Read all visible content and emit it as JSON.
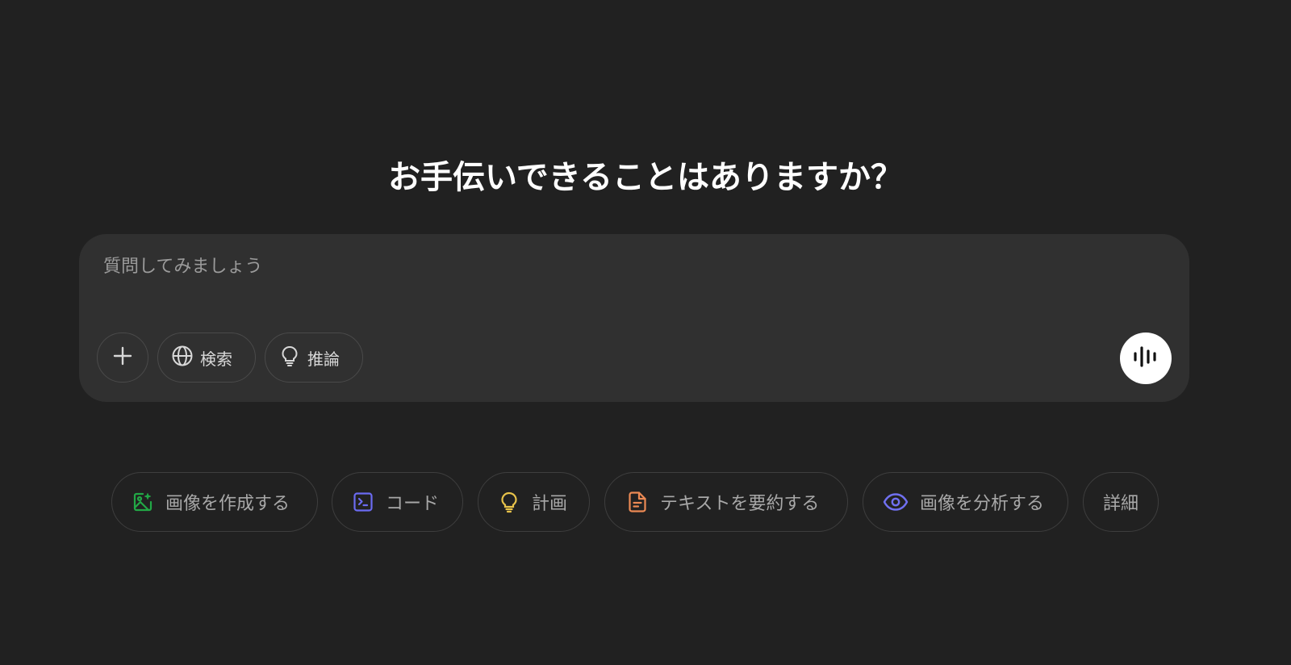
{
  "heading": "お手伝いできることはありますか？",
  "composer": {
    "placeholder": "質問してみましょう",
    "value": "",
    "tools": {
      "add_icon": "plus-icon",
      "search_label": "検索",
      "search_icon": "globe-icon",
      "reason_label": "推論",
      "reason_icon": "lightbulb-icon"
    },
    "voice_icon": "voice-waveform-icon"
  },
  "suggestions": [
    {
      "label": "画像を作成する",
      "icon": "image-create-icon",
      "color": "#22a846"
    },
    {
      "label": "コード",
      "icon": "terminal-icon",
      "color": "#6b6bf2"
    },
    {
      "label": "計画",
      "icon": "lightbulb-icon",
      "color": "#e8c34a"
    },
    {
      "label": "テキストを要約する",
      "icon": "document-icon",
      "color": "#ec8a54"
    },
    {
      "label": "画像を分析する",
      "icon": "eye-icon",
      "color": "#7070f0"
    },
    {
      "label": "詳細",
      "icon": "",
      "color": ""
    }
  ],
  "colors": {
    "background": "#212121",
    "composer": "#303030",
    "heading_text": "#ffffff",
    "chip_text": "#a8a8a8"
  }
}
